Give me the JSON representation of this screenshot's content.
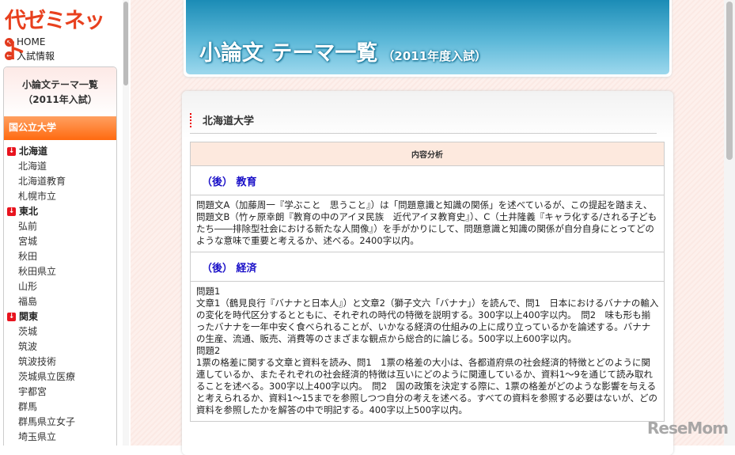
{
  "sidebar": {
    "logo": "代ゼミネット",
    "links": [
      {
        "label": "HOME"
      },
      {
        "label": "入試情報"
      }
    ],
    "box_title_1": "小論文テーマ一覧",
    "box_title_2": "（2011年入試）",
    "category": "国公立大学",
    "items": [
      {
        "label": "北海道",
        "region": true
      },
      {
        "label": "北海道"
      },
      {
        "label": "北海道教育"
      },
      {
        "label": "札幌市立"
      },
      {
        "label": "東北",
        "region": true
      },
      {
        "label": "弘前"
      },
      {
        "label": "宮城"
      },
      {
        "label": "秋田"
      },
      {
        "label": "秋田県立"
      },
      {
        "label": "山形"
      },
      {
        "label": "福島"
      },
      {
        "label": "関東",
        "region": true
      },
      {
        "label": "茨城"
      },
      {
        "label": "筑波"
      },
      {
        "label": "筑波技術"
      },
      {
        "label": "茨城県立医療"
      },
      {
        "label": "宇都宮"
      },
      {
        "label": "群馬"
      },
      {
        "label": "群馬県立女子"
      },
      {
        "label": "埼玉県立"
      }
    ]
  },
  "header": {
    "title": "小論文 テーマ一覧",
    "subtitle": "（2011年度入試）"
  },
  "content": {
    "university": "北海道大学",
    "table_header": "内容分析",
    "rows": [
      {
        "dept": "（後） 教育",
        "text": "問題文A（加藤周一『学ぶこと　思うこと』）は「問題意識と知識の関係」を述べているが、この提起を踏まえ、問題文B（竹ヶ原幸朗『教育の中のアイヌ民族　近代アイヌ教育史』）、C（土井隆義『キャラ化する/される子どもたち――排除型社会における新たな人間像』）を手がかりにして、問題意識と知識の関係が自分自身にとってどのような意味で重要と考えるか、述べる。2400字以内。"
      },
      {
        "dept": "（後） 経済",
        "text": "問題1\n文章1（鶴見良行『バナナと日本人』）と文章2（獅子文六「バナナ」）を読んで、問1　日本におけるバナナの輸入の変化を時代区分するとともに、それぞれの時代の特徴を説明する。300字以上400字以内。　問2　味も形も揃ったバナナを一年中安く食べられることが、いかなる経済の仕組みの上に成り立っているかを論述する。バナナの生産、流通、販売、消費等のさまざまな観点から総合的に論じる。500字以上600字以内。\n問題2\n1票の格差に関する文章と資料を読み、問1　1票の格差の大小は、各都道府県の社会経済的特徴とどのように関連しているか、またそれぞれの社会経済的特徴は互いにどのように関連しているか、資料1～9を通じて読み取れることを述べる。300字以上400字以内。　問2　国の政策を決定する際に、1票の格差がどのような影響を与えると考えられるか、資料1～15までを参照しつつ自分の考えを述べる。すべての資料を参照する必要はないが、どの資料を参照したかを解答の中で明記する。400字以上500字以内。"
      }
    ]
  },
  "watermark": "ReseMom"
}
